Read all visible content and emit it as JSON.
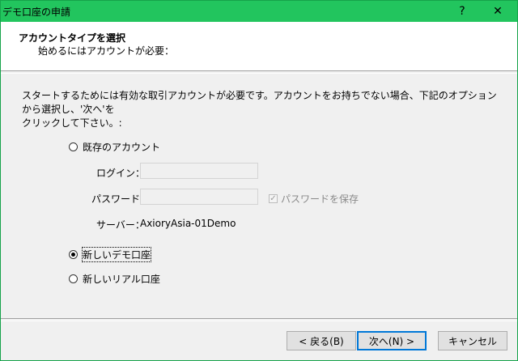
{
  "window": {
    "title": "デモ口座の申請",
    "help_glyph": "?",
    "close_glyph": "✕"
  },
  "header": {
    "title": "アカウントタイプを選択",
    "subtitle": "始めるにはアカウントが必要："
  },
  "intro": {
    "line1": "スタートするためには有効な取引アカウントが必要です。アカウントをお持ちでない場合、下記のオプションから選択し、'次へ'を",
    "line2": "クリックして下さい。:"
  },
  "options": {
    "existing": {
      "label": "既存のアカウント",
      "selected": false
    },
    "demo": {
      "label": "新しいデモ口座",
      "selected": true
    },
    "real": {
      "label": "新しいリアル口座",
      "selected": false
    }
  },
  "fields": {
    "login_label": "ログイン：",
    "login_value": "",
    "password_label": "パスワード：",
    "password_value": "",
    "save_password_label": "パスワードを保存",
    "save_password_checked": true,
    "server_label": "サーバー：",
    "server_value": "AxioryAsia-01Demo"
  },
  "buttons": {
    "back": "< 戻る(B)",
    "next": "次へ(N) >",
    "cancel": "キャンセル"
  },
  "colors": {
    "titlebar": "#22c55e",
    "default_button_border": "#0078d7"
  }
}
